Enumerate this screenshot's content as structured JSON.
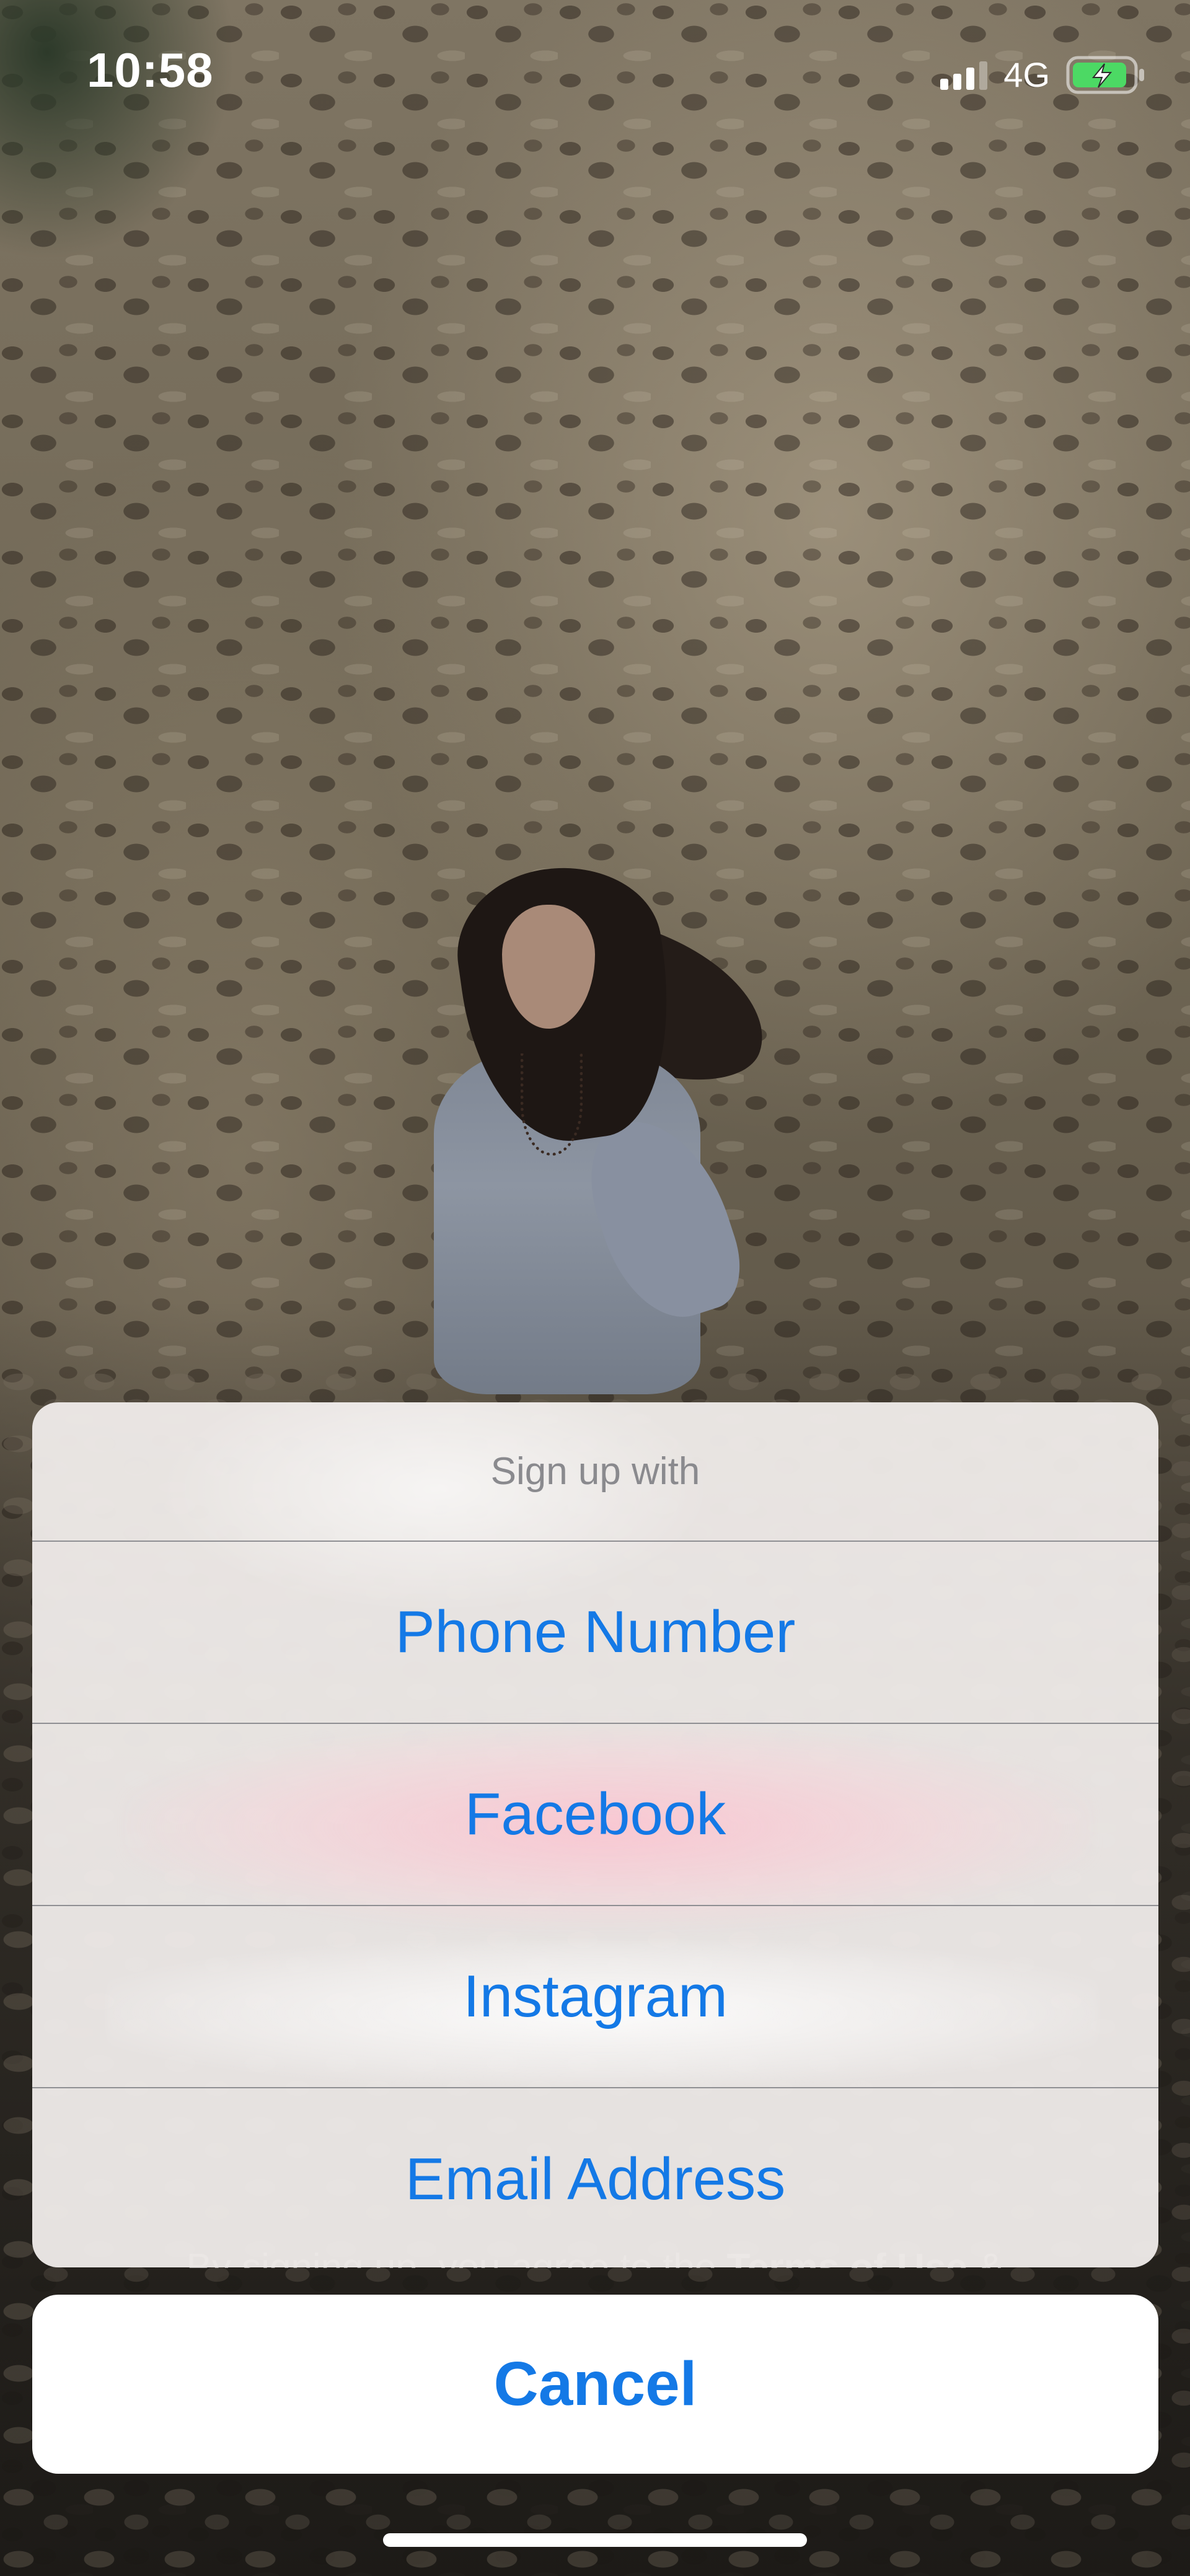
{
  "status_bar": {
    "time": "10:58",
    "network": "4G",
    "icons": [
      "signal-icon",
      "battery-charging-icon"
    ]
  },
  "action_sheet": {
    "title": "Sign up with",
    "options": [
      {
        "label": "Phone Number"
      },
      {
        "label": "Facebook"
      },
      {
        "label": "Instagram"
      },
      {
        "label": "Email Address"
      }
    ],
    "cancel_label": "Cancel"
  },
  "background": {
    "terms_prefix": "By signing up, you agree to the ",
    "terms_link": "Terms of Use",
    "terms_suffix": " &"
  },
  "colors": {
    "accent": "#1479e6",
    "battery_fill": "#4cd964"
  }
}
